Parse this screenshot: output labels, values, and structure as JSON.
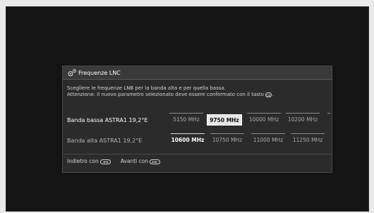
{
  "dialog": {
    "title": "Frequenze LNC",
    "instruction_line1": "Scegliere le frequenze LNB per la banda alta e per quella bassa.",
    "instruction_line2": "Attenzione: Il nuovo parametro selezionato deve essere confermato con il tasto",
    "ok_key_glyph": "OK"
  },
  "rows": {
    "low": {
      "label": "Banda bassa ASTRA1 19,2°E",
      "options": [
        "5150 MHz",
        "9750 MHz",
        "10000 MHz",
        "10200 MHz"
      ],
      "selected": "9750 MHz"
    },
    "high": {
      "label": "Banda alta ASTRA1 19,2°E",
      "options": [
        "10600 MHz",
        "10750 MHz",
        "11000 MHz",
        "11250 MHz"
      ],
      "current": "10600 MHz"
    }
  },
  "footer": {
    "back_label": "Indietro con",
    "back_key": "◄◄",
    "next_label": "Avanti con",
    "next_key": "►►"
  },
  "colors": {
    "background": "#141414",
    "dialog": "#2b2b2b",
    "selected_bg": "#e6e6e6"
  }
}
